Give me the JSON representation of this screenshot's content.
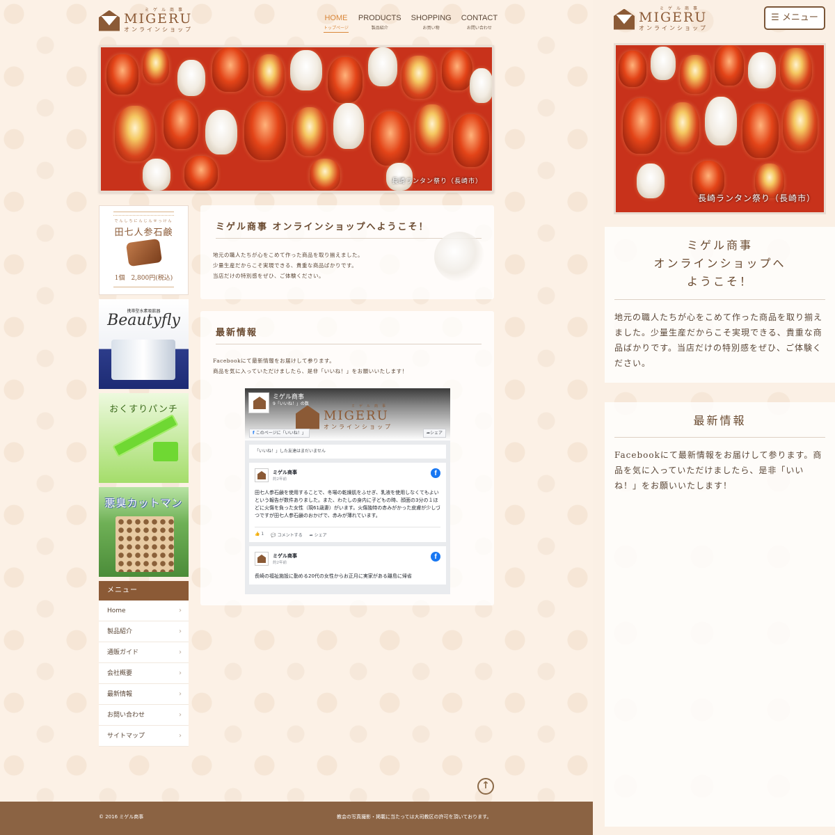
{
  "logo": {
    "main": "MIGERU",
    "ruby": "ミゲル商事",
    "sub": "オンラインショップ"
  },
  "nav": [
    {
      "en": "HOME",
      "ja": "トップページ"
    },
    {
      "en": "PRODUCTS",
      "ja": "製品紹介"
    },
    {
      "en": "SHOPPING",
      "ja": "お買い物"
    },
    {
      "en": "CONTACT",
      "ja": "お問い合わせ"
    }
  ],
  "hero": {
    "caption": "長崎ランタン祭り（長崎市）"
  },
  "banners": {
    "soap": {
      "ruby": "でんしちにんじんせっけん",
      "title": "田七人参石鹸",
      "price": "1個　2,800円(税込)"
    },
    "beauty": {
      "top": "携帯型水素吸飲器",
      "title": "Beautyfly"
    },
    "pill": {
      "title": "おくすりパンチ"
    },
    "odor": {
      "title": "悪臭カットマン"
    }
  },
  "side_menu": {
    "heading": "メニュー",
    "items": [
      "Home",
      "製品紹介",
      "通販ガイド",
      "会社概要",
      "最新情報",
      "お問い合わせ",
      "サイトマップ"
    ]
  },
  "welcome": {
    "title": "ミゲル商事 オンラインショップへようこそ！",
    "lines": [
      "地元の職人たちが心をこめて作った商品を取り揃えました。",
      "少量生産だからこそ実現できる、貴重な商品ばかりです。",
      "当店だけの特別感をぜひ、ご体験ください。"
    ]
  },
  "news": {
    "title": "最新情報",
    "lines": [
      "Facebookにて最新情報をお届けして参ります。",
      "商品を気に入っていただけましたら、是非「いいね！」をお願いいたします！"
    ]
  },
  "facebook": {
    "page_name": "ミゲル商事",
    "likes": "9「いいね！」の数",
    "like_button": "このページに「いいね！」",
    "share_button": "シェア",
    "friends_text": "「いいね！」した友達はまだいません",
    "posts": [
      {
        "author": "ミゲル商事",
        "time": "約2年前",
        "text": "田七人参石鹸を使用することで、冬場の乾燥肌をふせぎ、乳液を使用しなくてもよいという報告が数件ありました。また、わたしの身内に子どもの時、顔面の3分の１ほどに火傷を負った女性（現61歳妻）がいます。火傷独特の赤みがかった皮膚が少しづつですが田七人参石鹸のおかげで、赤みが薄れています。",
        "like_count": "1",
        "comment": "コメントする",
        "share": "シェア"
      },
      {
        "author": "ミゲル商事",
        "time": "約2年前",
        "text": "長崎の福祉施設に勤める20代の女性からお正月に実家がある離島に帰省"
      }
    ]
  },
  "footer": {
    "copyright": "© 2016 ミゲル商事",
    "note": "教会の写真撮影・掲載に当たっては大司教区の許可を頂いております。"
  },
  "mobile": {
    "menu_button": "メニュー",
    "welcome_title_lines": [
      "ミゲル商事",
      "オンラインショップへ",
      "ようこそ！"
    ],
    "welcome_body": "地元の職人たちが心をこめて作った商品を取り揃えました。少量生産だからこそ実現できる、貴重な商品ばかりです。当店だけの特別感をぜひ、ご体験ください。",
    "news_title": "最新情報",
    "news_body": "Facebookにて最新情報をお届けして参ります。商品を気に入っていただけましたら、是非「いいね！」をお願いいたします！"
  },
  "colors": {
    "brand_brown": "#8b5a36",
    "nav_active": "#d9873a",
    "footer_bg": "#8b6343",
    "facebook_blue": "#1877f2"
  }
}
